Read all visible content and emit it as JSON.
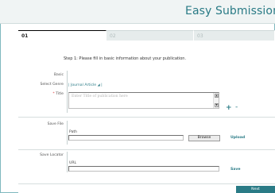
{
  "header": {
    "title": "Easy Submission"
  },
  "steps": [
    {
      "num": "01",
      "active": true
    },
    {
      "num": "02",
      "active": false
    },
    {
      "num": "03",
      "active": false
    }
  ],
  "instruction": "Step 1: Please fill in basic information about your publication.",
  "basic": {
    "section_label": "Basic",
    "genre_label": "Select Genre",
    "genre_value": "Journal Article",
    "title_label": "Title",
    "title_placeholder": "Enter Title of publication here"
  },
  "save_file": {
    "section_label": "Save File",
    "path_label": "Path",
    "browse_label": "Browse",
    "upload_label": "Upload"
  },
  "save_locator": {
    "section_label": "Save Locator",
    "url_label": "URL",
    "save_label": "Save"
  },
  "footer": {
    "next_label": "Next"
  },
  "colors": {
    "accent": "#2a7b86",
    "border": "#7fb8be"
  }
}
